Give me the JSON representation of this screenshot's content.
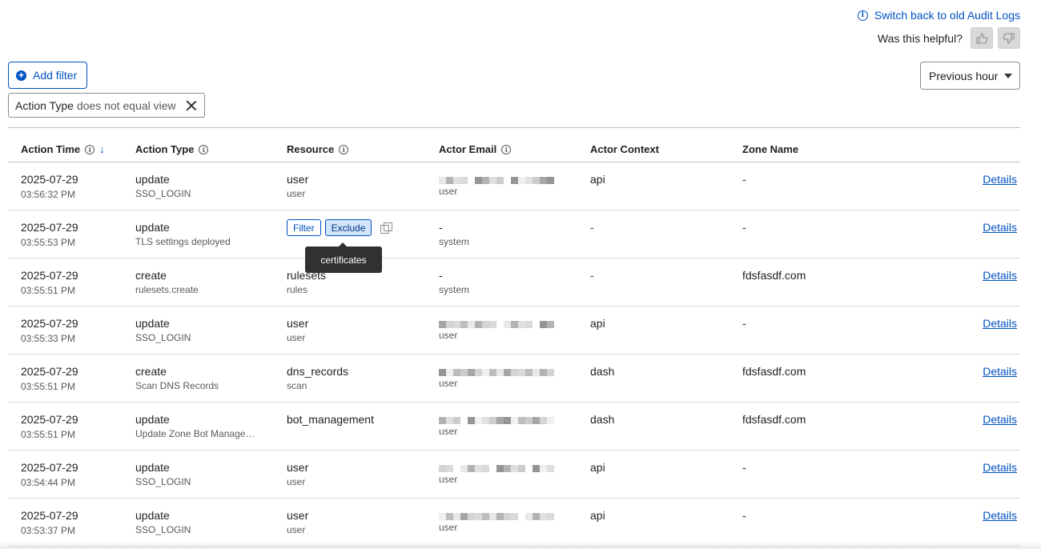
{
  "header": {
    "switch_link": "Switch back to old Audit Logs",
    "helpful_text": "Was this helpful?"
  },
  "toolbar": {
    "add_filter_label": "Add filter",
    "time_range": "Previous hour"
  },
  "active_filter": {
    "field": "Action Type",
    "operator": "does not equal view"
  },
  "columns": {
    "action_time": "Action Time",
    "action_type": "Action Type",
    "resource": "Resource",
    "actor_email": "Actor Email",
    "actor_context": "Actor Context",
    "zone_name": "Zone Name"
  },
  "hover_actions": {
    "filter": "Filter",
    "exclude": "Exclude",
    "tooltip": "certificates"
  },
  "details_label": "Details",
  "rows": [
    {
      "date": "2025-07-29",
      "time": "03:56:32 PM",
      "type": "update",
      "type_sub": "SSO_LOGIN",
      "resource": "user",
      "resource_sub": "user",
      "email": "",
      "email_sub": "user",
      "redacted": true,
      "context": "api",
      "zone": "-"
    },
    {
      "date": "2025-07-29",
      "time": "03:55:53 PM",
      "type": "update",
      "type_sub": "TLS settings deployed",
      "resource": "certificates",
      "resource_sub": "",
      "email": "-",
      "email_sub": "system",
      "redacted": false,
      "context": "-",
      "zone": "-"
    },
    {
      "date": "2025-07-29",
      "time": "03:55:51 PM",
      "type": "create",
      "type_sub": "rulesets.create",
      "resource": "rulesets",
      "resource_sub": "rules",
      "email": "-",
      "email_sub": "system",
      "redacted": false,
      "context": "-",
      "zone": "fdsfasdf.com"
    },
    {
      "date": "2025-07-29",
      "time": "03:55:33 PM",
      "type": "update",
      "type_sub": "SSO_LOGIN",
      "resource": "user",
      "resource_sub": "user",
      "email": "",
      "email_sub": "user",
      "redacted": true,
      "context": "api",
      "zone": "-"
    },
    {
      "date": "2025-07-29",
      "time": "03:55:51 PM",
      "type": "create",
      "type_sub": "Scan DNS Records",
      "resource": "dns_records",
      "resource_sub": "scan",
      "email": "",
      "email_sub": "user",
      "redacted": true,
      "context": "dash",
      "zone": "fdsfasdf.com"
    },
    {
      "date": "2025-07-29",
      "time": "03:55:51 PM",
      "type": "update",
      "type_sub": "Update Zone Bot Manage…",
      "resource": "bot_management",
      "resource_sub": "",
      "email": "",
      "email_sub": "user",
      "redacted": true,
      "context": "dash",
      "zone": "fdsfasdf.com"
    },
    {
      "date": "2025-07-29",
      "time": "03:54:44 PM",
      "type": "update",
      "type_sub": "SSO_LOGIN",
      "resource": "user",
      "resource_sub": "user",
      "email": "",
      "email_sub": "user",
      "redacted": true,
      "context": "api",
      "zone": "-"
    },
    {
      "date": "2025-07-29",
      "time": "03:53:37 PM",
      "type": "update",
      "type_sub": "SSO_LOGIN",
      "resource": "user",
      "resource_sub": "user",
      "email": "",
      "email_sub": "user",
      "redacted": true,
      "context": "api",
      "zone": "-"
    }
  ]
}
